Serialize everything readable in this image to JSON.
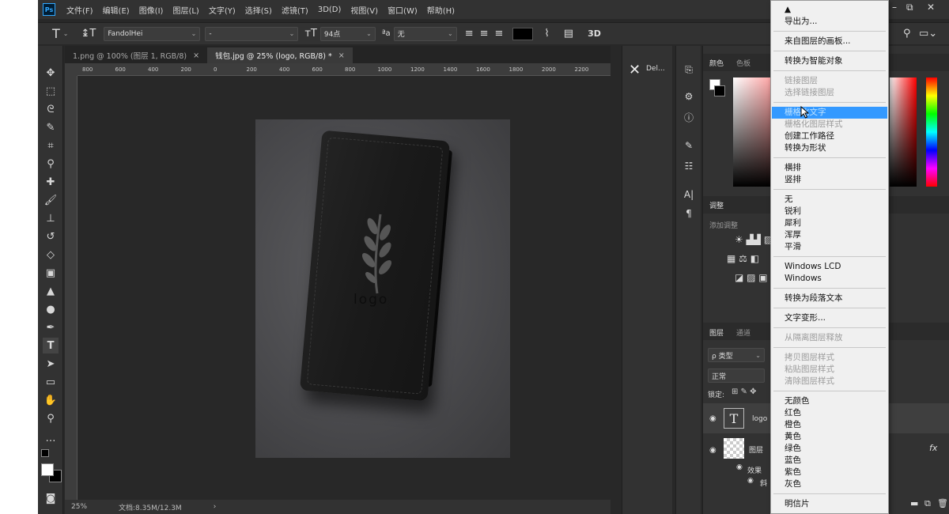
{
  "app": {
    "logo_text": "Ps",
    "menus": [
      "文件(F)",
      "编辑(E)",
      "图像(I)",
      "图层(L)",
      "文字(Y)",
      "选择(S)",
      "滤镜(T)",
      "3D(D)",
      "视图(V)",
      "窗口(W)",
      "帮助(H)"
    ]
  },
  "options": {
    "tool_glyph": "T",
    "font_family": "FandolHei",
    "font_style": "-",
    "font_size": "94点",
    "antialias_glyph": "ªa",
    "antialias": "无",
    "mode_3d": "3D"
  },
  "tabs": [
    {
      "label": "1.png @ 100% (图层 1, RGB/8)",
      "close": "×"
    },
    {
      "label": "钱包.jpg @ 25% (logo, RGB/8) *",
      "close": "×"
    }
  ],
  "ruler_h": [
    "800",
    "600",
    "400",
    "200",
    "0",
    "200",
    "400",
    "600",
    "800",
    "1000",
    "1200",
    "1400",
    "1600",
    "1800",
    "2000",
    "2200"
  ],
  "canvas": {
    "logo_text": "logo"
  },
  "status": {
    "zoom": "25%",
    "doc": "文档:8.35M/12.3M",
    "arrow": "›"
  },
  "collapsed_panel": {
    "label": "Del..."
  },
  "panels": {
    "color_tab": "颜色",
    "swatches_tab": "色板",
    "adjust_title": "调整",
    "adjust_add": "添加调整",
    "layers_tab": "图层",
    "channels_tab": "通道",
    "filter_kind": "ρ 类型",
    "blend_mode": "正常",
    "lock_label": "锁定:",
    "layer1_name": "logo",
    "layer2_name": "图层",
    "effects_label": "效果",
    "sub_effect": "斜",
    "fx": "fx"
  },
  "context_menu": [
    {
      "label": "▲",
      "state": "normal",
      "sep_after": false
    },
    {
      "label": "导出为...",
      "state": "normal",
      "sep_after": true
    },
    {
      "label": "来自图层的画板...",
      "state": "normal",
      "sep_after": true
    },
    {
      "label": "转换为智能对象",
      "state": "normal",
      "sep_after": true
    },
    {
      "label": "链接图层",
      "state": "disabled",
      "sep_after": false
    },
    {
      "label": "选择链接图层",
      "state": "disabled",
      "sep_after": true
    },
    {
      "label": "栅格化文字",
      "state": "highlighted",
      "sep_after": false
    },
    {
      "label": "栅格化图层样式",
      "state": "disabled",
      "sep_after": false
    },
    {
      "label": "创建工作路径",
      "state": "normal",
      "sep_after": false
    },
    {
      "label": "转换为形状",
      "state": "normal",
      "sep_after": true
    },
    {
      "label": "横排",
      "state": "normal",
      "sep_after": false
    },
    {
      "label": "竖排",
      "state": "normal",
      "sep_after": true
    },
    {
      "label": "无",
      "state": "normal",
      "sep_after": false
    },
    {
      "label": "锐利",
      "state": "normal",
      "sep_after": false
    },
    {
      "label": "犀利",
      "state": "normal",
      "sep_after": false
    },
    {
      "label": "浑厚",
      "state": "normal",
      "sep_after": false
    },
    {
      "label": "平滑",
      "state": "normal",
      "sep_after": true
    },
    {
      "label": "Windows LCD",
      "state": "normal",
      "sep_after": false
    },
    {
      "label": "Windows",
      "state": "normal",
      "sep_after": true
    },
    {
      "label": "转换为段落文本",
      "state": "normal",
      "sep_after": true
    },
    {
      "label": "文字变形...",
      "state": "normal",
      "sep_after": true
    },
    {
      "label": "从隔离图层释放",
      "state": "disabled",
      "sep_after": true
    },
    {
      "label": "拷贝图层样式",
      "state": "disabled",
      "sep_after": false
    },
    {
      "label": "粘贴图层样式",
      "state": "disabled",
      "sep_after": false
    },
    {
      "label": "清除图层样式",
      "state": "disabled",
      "sep_after": true
    },
    {
      "label": "无颜色",
      "state": "normal",
      "sep_after": false
    },
    {
      "label": "红色",
      "state": "normal",
      "sep_after": false
    },
    {
      "label": "橙色",
      "state": "normal",
      "sep_after": false
    },
    {
      "label": "黄色",
      "state": "normal",
      "sep_after": false
    },
    {
      "label": "绿色",
      "state": "normal",
      "sep_after": false
    },
    {
      "label": "蓝色",
      "state": "normal",
      "sep_after": false
    },
    {
      "label": "紫色",
      "state": "normal",
      "sep_after": false
    },
    {
      "label": "灰色",
      "state": "normal",
      "sep_after": true
    },
    {
      "label": "明信片",
      "state": "normal",
      "sep_after": false
    }
  ]
}
